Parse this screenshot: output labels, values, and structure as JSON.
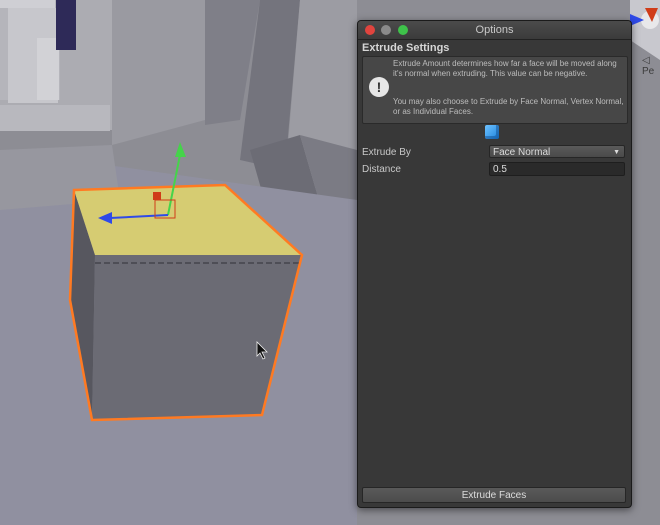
{
  "window": {
    "title": "Options",
    "section_title": "Extrude Settings",
    "help_text_1": "Extrude Amount determines how far a face will be moved along it's normal when extruding. This value can be negative.",
    "help_text_2": "You may also choose to Extrude by Face Normal, Vertex Normal, or as Individual Faces.",
    "warning_glyph": "!",
    "fields": {
      "extrude_by_label": "Extrude By",
      "extrude_by_value": "Face Normal",
      "distance_label": "Distance",
      "distance_value": "0.5"
    },
    "button_label": "Extrude Faces",
    "caret_glyph": "▼"
  },
  "scene": {
    "perspective_label": "◁ Pe",
    "colors": {
      "selection_outline": "#ff7a22",
      "selected_face": "#d8d070",
      "gizmo_y": "#45d44a",
      "gizmo_x": "#2f4ae8",
      "gizmo_origin": "#d03c18"
    },
    "icons": [
      "move-gizmo-icon",
      "mouse-cursor-icon",
      "scene-orientation-gizmo-icon"
    ]
  }
}
